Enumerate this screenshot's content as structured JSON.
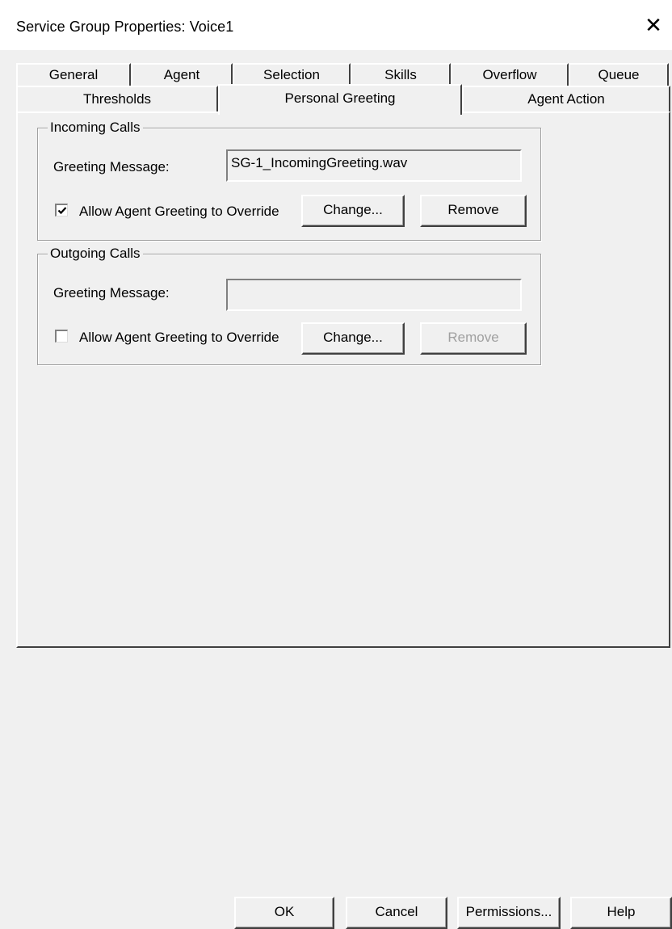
{
  "window": {
    "title": "Service Group Properties: Voice1",
    "close_glyph": "✕"
  },
  "tabs": {
    "row1": [
      "General",
      "Agent",
      "Selection",
      "Skills",
      "Overflow",
      "Queue"
    ],
    "row2": [
      "Thresholds",
      "Personal Greeting",
      "Agent Action"
    ],
    "active": "Personal Greeting"
  },
  "incoming": {
    "legend": "Incoming Calls",
    "greeting_label": "Greeting Message:",
    "greeting_value": "SG-1_IncomingGreeting.wav",
    "allow_label": "Allow Agent Greeting to Override",
    "allow_checked": true,
    "change_label": "Change...",
    "remove_label": "Remove"
  },
  "outgoing": {
    "legend": "Outgoing Calls",
    "greeting_label": "Greeting Message:",
    "greeting_value": "",
    "allow_label": "Allow Agent Greeting to Override",
    "allow_checked": false,
    "change_label": "Change...",
    "remove_label": "Remove",
    "remove_disabled": true
  },
  "footer": {
    "ok_label": "OK",
    "cancel_label": "Cancel",
    "permissions_label": "Permissions...",
    "help_label": "Help"
  },
  "icons": {
    "close": "close-icon",
    "check": "checkmark-icon"
  }
}
